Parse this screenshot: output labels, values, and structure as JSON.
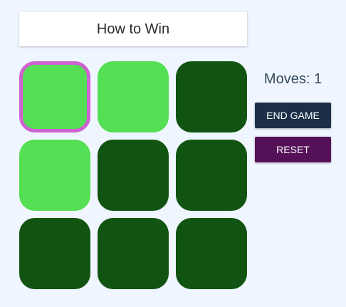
{
  "header": {
    "how_to_win_label": "How to Win"
  },
  "status": {
    "moves_label": "Moves:",
    "moves_value": "1"
  },
  "controls": {
    "end_game_label": "END GAME",
    "reset_label": "RESET"
  },
  "board": {
    "rows": 3,
    "cols": 3,
    "tiles": [
      [
        "on",
        "on",
        "off"
      ],
      [
        "on",
        "off",
        "off"
      ],
      [
        "off",
        "off",
        "off"
      ]
    ],
    "selected": [
      0,
      0
    ]
  },
  "colors": {
    "background": "#f0f6ff",
    "tile_on": "#54df54",
    "tile_off": "#115412",
    "selection_border": "#d061d2",
    "end_game_button": "#1b3048",
    "reset_button": "#551157"
  }
}
